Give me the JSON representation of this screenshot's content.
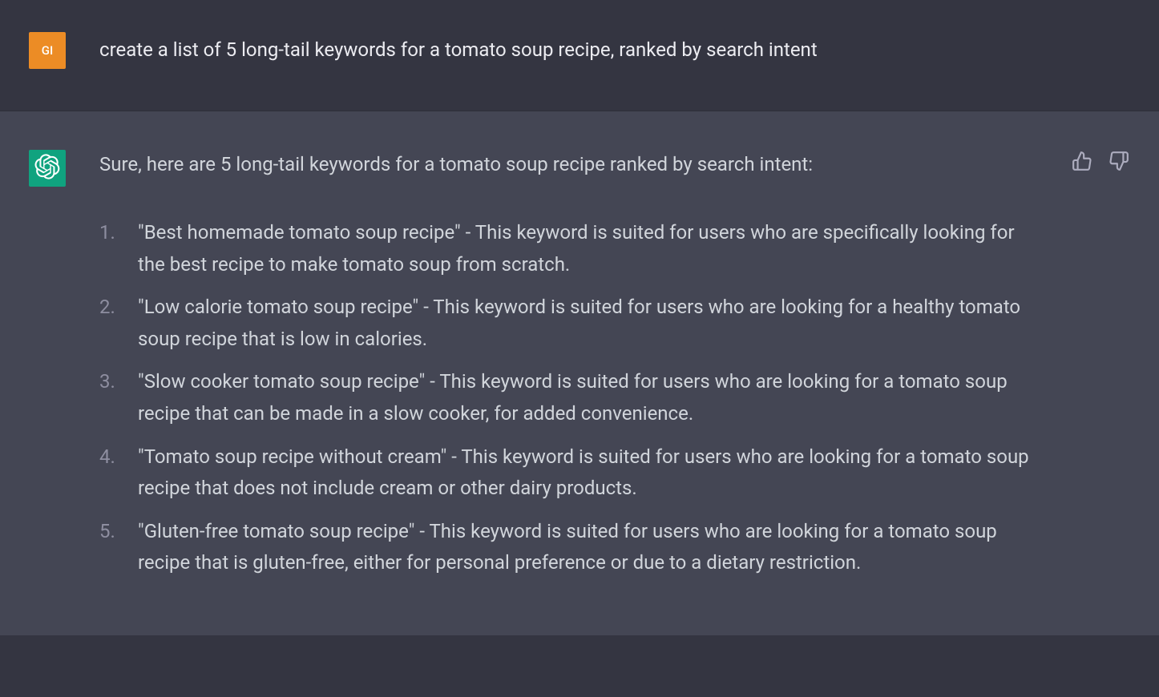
{
  "user": {
    "avatar_initials": "GI",
    "message": "create a list of 5 long-tail keywords for a tomato soup recipe, ranked by search intent"
  },
  "assistant": {
    "intro": "Sure, here are 5 long-tail keywords for a tomato soup recipe ranked by search intent:",
    "items": [
      "\"Best homemade tomato soup recipe\" - This keyword is suited for users who are specifically looking for the best recipe to make tomato soup from scratch.",
      "\"Low calorie tomato soup recipe\" - This keyword is suited for users who are looking for a healthy tomato soup recipe that is low in calories.",
      "\"Slow cooker tomato soup recipe\" - This keyword is suited for users who are looking for a tomato soup recipe that can be made in a slow cooker, for added convenience.",
      "\"Tomato soup recipe without cream\" - This keyword is suited for users who are looking for a tomato soup recipe that does not include cream or other dairy products.",
      "\"Gluten-free tomato soup recipe\" - This keyword is suited for users who are looking for a tomato soup recipe that is gluten-free, either for personal preference or due to a dietary restriction."
    ]
  }
}
